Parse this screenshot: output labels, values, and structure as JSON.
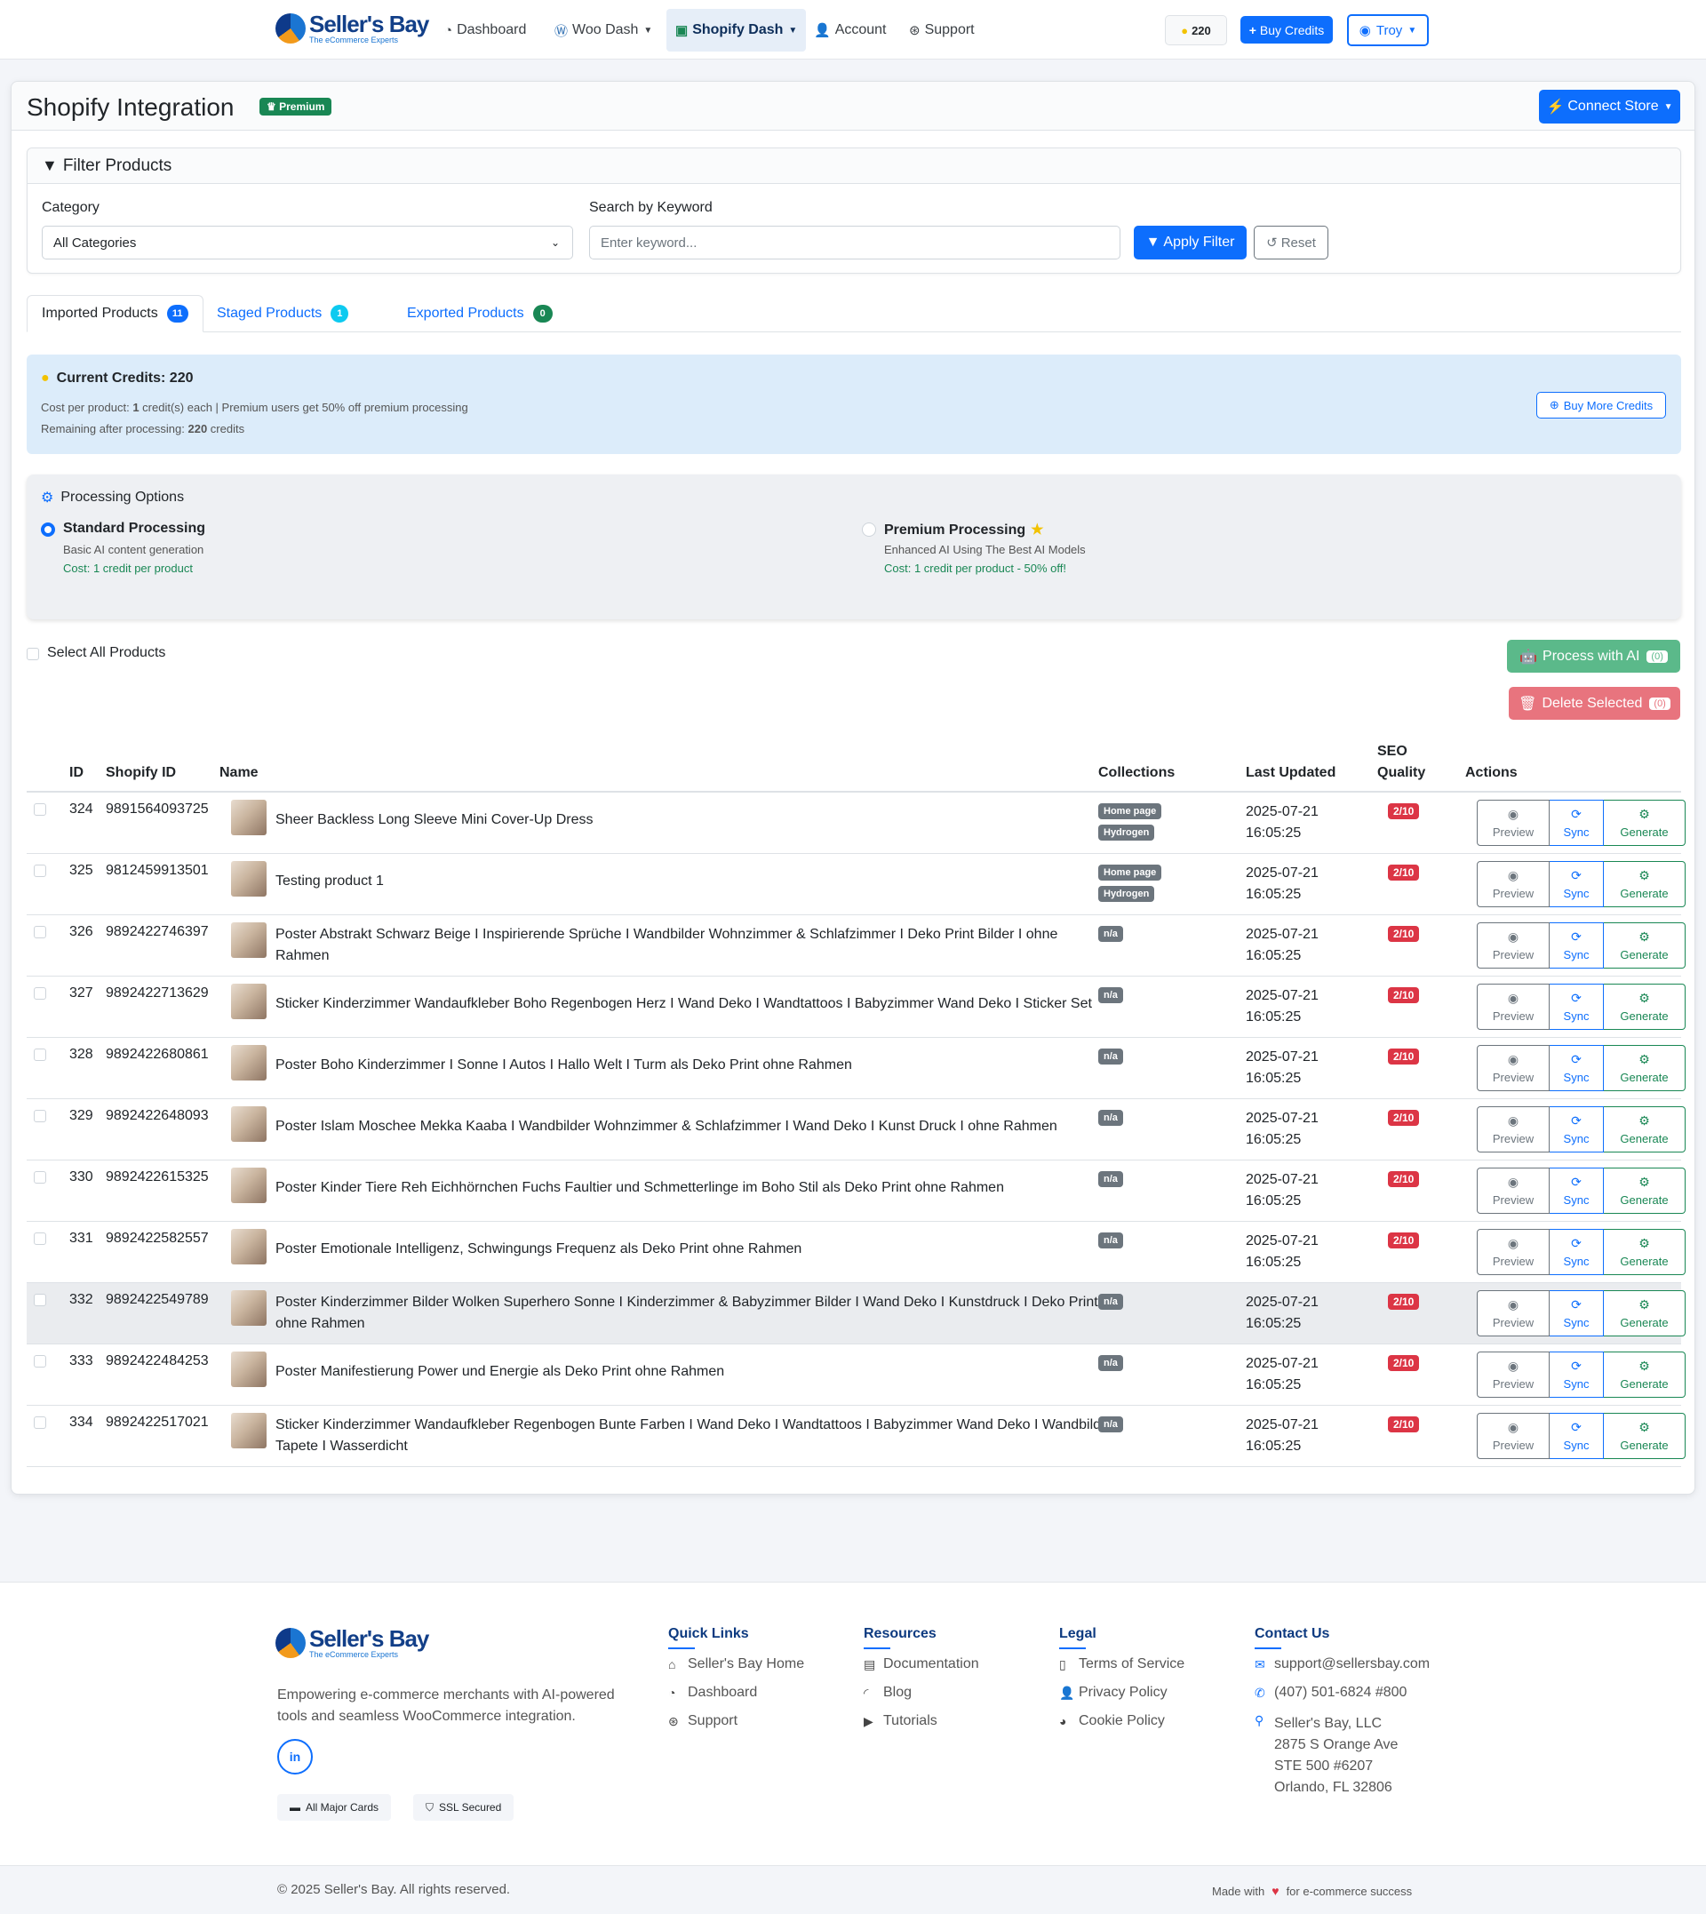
{
  "brand": {
    "name": "Seller's Bay",
    "tagline": "The eCommerce Experts"
  },
  "nav": {
    "items": [
      {
        "label": "Dashboard",
        "icon": "gauge-icon"
      },
      {
        "label": "Woo Dash",
        "icon": "wordpress-icon"
      },
      {
        "label": "Shopify Dash",
        "icon": "shopify-bag-icon",
        "active": true
      },
      {
        "label": "Account",
        "icon": "user-gear-icon"
      },
      {
        "label": "Support",
        "icon": "lifebuoy-icon"
      }
    ],
    "credits": "220",
    "buy_credits": "Buy Credits",
    "user": "Troy"
  },
  "page": {
    "title": "Shopify Integration",
    "badge": "Premium",
    "connect_store": "Connect Store"
  },
  "filter": {
    "title": "Filter Products",
    "category_label": "Category",
    "category_value": "All Categories",
    "keyword_label": "Search by Keyword",
    "keyword_placeholder": "Enter keyword...",
    "apply": "Apply Filter",
    "reset": "Reset"
  },
  "tabs": [
    {
      "label": "Imported Products",
      "count": "11",
      "color": "#0d6efd"
    },
    {
      "label": "Staged Products",
      "count": "1",
      "color": "#0dcaf0"
    },
    {
      "label": "Exported Products",
      "count": "0",
      "color": "#198754"
    }
  ],
  "credits": {
    "title": "Current Credits: 220",
    "line1_pre": "Cost per product: ",
    "line1_bold": "1",
    "line1_post": " credit(s) each | Premium users get 50% off premium processing",
    "line2_pre": "Remaining after processing: ",
    "line2_bold": "220",
    "line2_post": " credits",
    "buy_more": "Buy More Credits"
  },
  "processing": {
    "title": "Processing Options",
    "standard": {
      "name": "Standard Processing",
      "desc": "Basic AI content generation",
      "cost": "Cost: 1 credit per product"
    },
    "premium": {
      "name": "Premium Processing",
      "desc": "Enhanced AI Using The Best AI Models",
      "cost": "Cost: 1 credit per product - 50% off!"
    }
  },
  "bulk": {
    "select_all": "Select All Products",
    "process_ai": "Process with AI",
    "process_count": "(0)",
    "delete": "Delete Selected",
    "delete_count": "(0)"
  },
  "table": {
    "headers": {
      "id": "ID",
      "shopify_id": "Shopify ID",
      "name": "Name",
      "collections": "Collections",
      "updated": "Last Updated",
      "seo1": "SEO",
      "seo2": "Quality",
      "actions": "Actions"
    },
    "action_labels": {
      "preview": "Preview",
      "sync": "Sync",
      "generate": "Generate"
    },
    "rows": [
      {
        "id": "324",
        "shopify_id": "9891564093725",
        "name1": "Sheer Backless Long Sleeve Mini Cover-Up Dress",
        "name2": "",
        "collections": [
          "Home page",
          "Hydrogen"
        ],
        "date": "2025-07-21",
        "time": "16:05:25",
        "seo": "2/10"
      },
      {
        "id": "325",
        "shopify_id": "9812459913501",
        "name1": "Testing product 1",
        "name2": "",
        "collections": [
          "Home page",
          "Hydrogen"
        ],
        "date": "2025-07-21",
        "time": "16:05:25",
        "seo": "2/10"
      },
      {
        "id": "326",
        "shopify_id": "9892422746397",
        "name1": "Poster Abstrakt Schwarz Beige I Inspirierende Sprüche I Wandbilder Wohnzimmer & Schlafzimmer I Deko Print Bilder I ohne",
        "name2": "Rahmen",
        "collections": [
          "n/a"
        ],
        "date": "2025-07-21",
        "time": "16:05:25",
        "seo": "2/10"
      },
      {
        "id": "327",
        "shopify_id": "9892422713629",
        "name1": "Sticker Kinderzimmer Wandaufkleber Boho Regenbogen Herz I Wand Deko I Wandtattoos I Babyzimmer Wand Deko I Sticker Set",
        "name2": "",
        "collections": [
          "n/a"
        ],
        "date": "2025-07-21",
        "time": "16:05:25",
        "seo": "2/10"
      },
      {
        "id": "328",
        "shopify_id": "9892422680861",
        "name1": "Poster Boho Kinderzimmer I Sonne I Autos I Hallo Welt I Turm als Deko Print ohne Rahmen",
        "name2": "",
        "collections": [
          "n/a"
        ],
        "date": "2025-07-21",
        "time": "16:05:25",
        "seo": "2/10"
      },
      {
        "id": "329",
        "shopify_id": "9892422648093",
        "name1": "Poster Islam Moschee Mekka Kaaba I Wandbilder Wohnzimmer & Schlafzimmer I Wand Deko I Kunst Druck I ohne Rahmen",
        "name2": "",
        "collections": [
          "n/a"
        ],
        "date": "2025-07-21",
        "time": "16:05:25",
        "seo": "2/10"
      },
      {
        "id": "330",
        "shopify_id": "9892422615325",
        "name1": "Poster Kinder Tiere Reh Eichhörnchen Fuchs Faultier und Schmetterlinge im Boho Stil als Deko Print ohne Rahmen",
        "name2": "",
        "collections": [
          "n/a"
        ],
        "date": "2025-07-21",
        "time": "16:05:25",
        "seo": "2/10"
      },
      {
        "id": "331",
        "shopify_id": "9892422582557",
        "name1": "Poster Emotionale Intelligenz, Schwingungs Frequenz als Deko Print ohne Rahmen",
        "name2": "",
        "collections": [
          "n/a"
        ],
        "date": "2025-07-21",
        "time": "16:05:25",
        "seo": "2/10"
      },
      {
        "id": "332",
        "shopify_id": "9892422549789",
        "name1": "Poster Kinderzimmer Bilder Wolken Superhero Sonne I Kinderzimmer & Babyzimmer Bilder I Wand Deko I Kunstdruck I Deko Print I",
        "name2": "ohne Rahmen",
        "collections": [
          "n/a"
        ],
        "date": "2025-07-21",
        "time": "16:05:25",
        "seo": "2/10",
        "highlight": true
      },
      {
        "id": "333",
        "shopify_id": "9892422484253",
        "name1": "Poster Manifestierung Power und Energie als Deko Print ohne Rahmen",
        "name2": "",
        "collections": [
          "n/a"
        ],
        "date": "2025-07-21",
        "time": "16:05:25",
        "seo": "2/10"
      },
      {
        "id": "334",
        "shopify_id": "9892422517021",
        "name1": "Sticker Kinderzimmer Wandaufkleber Regenbogen Bunte Farben I Wand Deko I Wandtattoos I Babyzimmer Wand Deko I Wandbild",
        "name2": "Tapete I Wasserdicht",
        "collections": [
          "n/a"
        ],
        "date": "2025-07-21",
        "time": "16:05:25",
        "seo": "2/10"
      }
    ]
  },
  "footer": {
    "about1": "Empowering e-commerce merchants with AI-powered",
    "about2": "tools and seamless WooCommerce integration.",
    "social": "in",
    "chip1": "All Major Cards",
    "chip2": "SSL Secured",
    "cols": [
      {
        "title": "Quick Links",
        "links": [
          {
            "label": "Seller's Bay Home",
            "icon": "house-icon"
          },
          {
            "label": "Dashboard",
            "icon": "gauge-icon"
          },
          {
            "label": "Support",
            "icon": "lifebuoy-icon"
          }
        ]
      },
      {
        "title": "Resources",
        "links": [
          {
            "label": "Documentation",
            "icon": "book-icon"
          },
          {
            "label": "Blog",
            "icon": "rss-icon"
          },
          {
            "label": "Tutorials",
            "icon": "play-circle-icon"
          }
        ]
      },
      {
        "title": "Legal",
        "links": [
          {
            "label": "Terms of Service",
            "icon": "file-icon"
          },
          {
            "label": "Privacy Policy",
            "icon": "user-shield-icon"
          },
          {
            "label": "Cookie Policy",
            "icon": "cookie-icon"
          }
        ]
      }
    ],
    "contact_title": "Contact Us",
    "email": "support@sellersbay.com",
    "phone": "(407) 501-6824 #800",
    "addr1": "Seller's Bay, LLC",
    "addr2": "2875 S Orange Ave",
    "addr3": "STE 500 #6207",
    "addr4": "Orlando, FL 32806",
    "copyright": "© 2025 Seller's Bay. All rights reserved.",
    "made_pre": "Made with",
    "made_post": "for e-commerce success"
  }
}
